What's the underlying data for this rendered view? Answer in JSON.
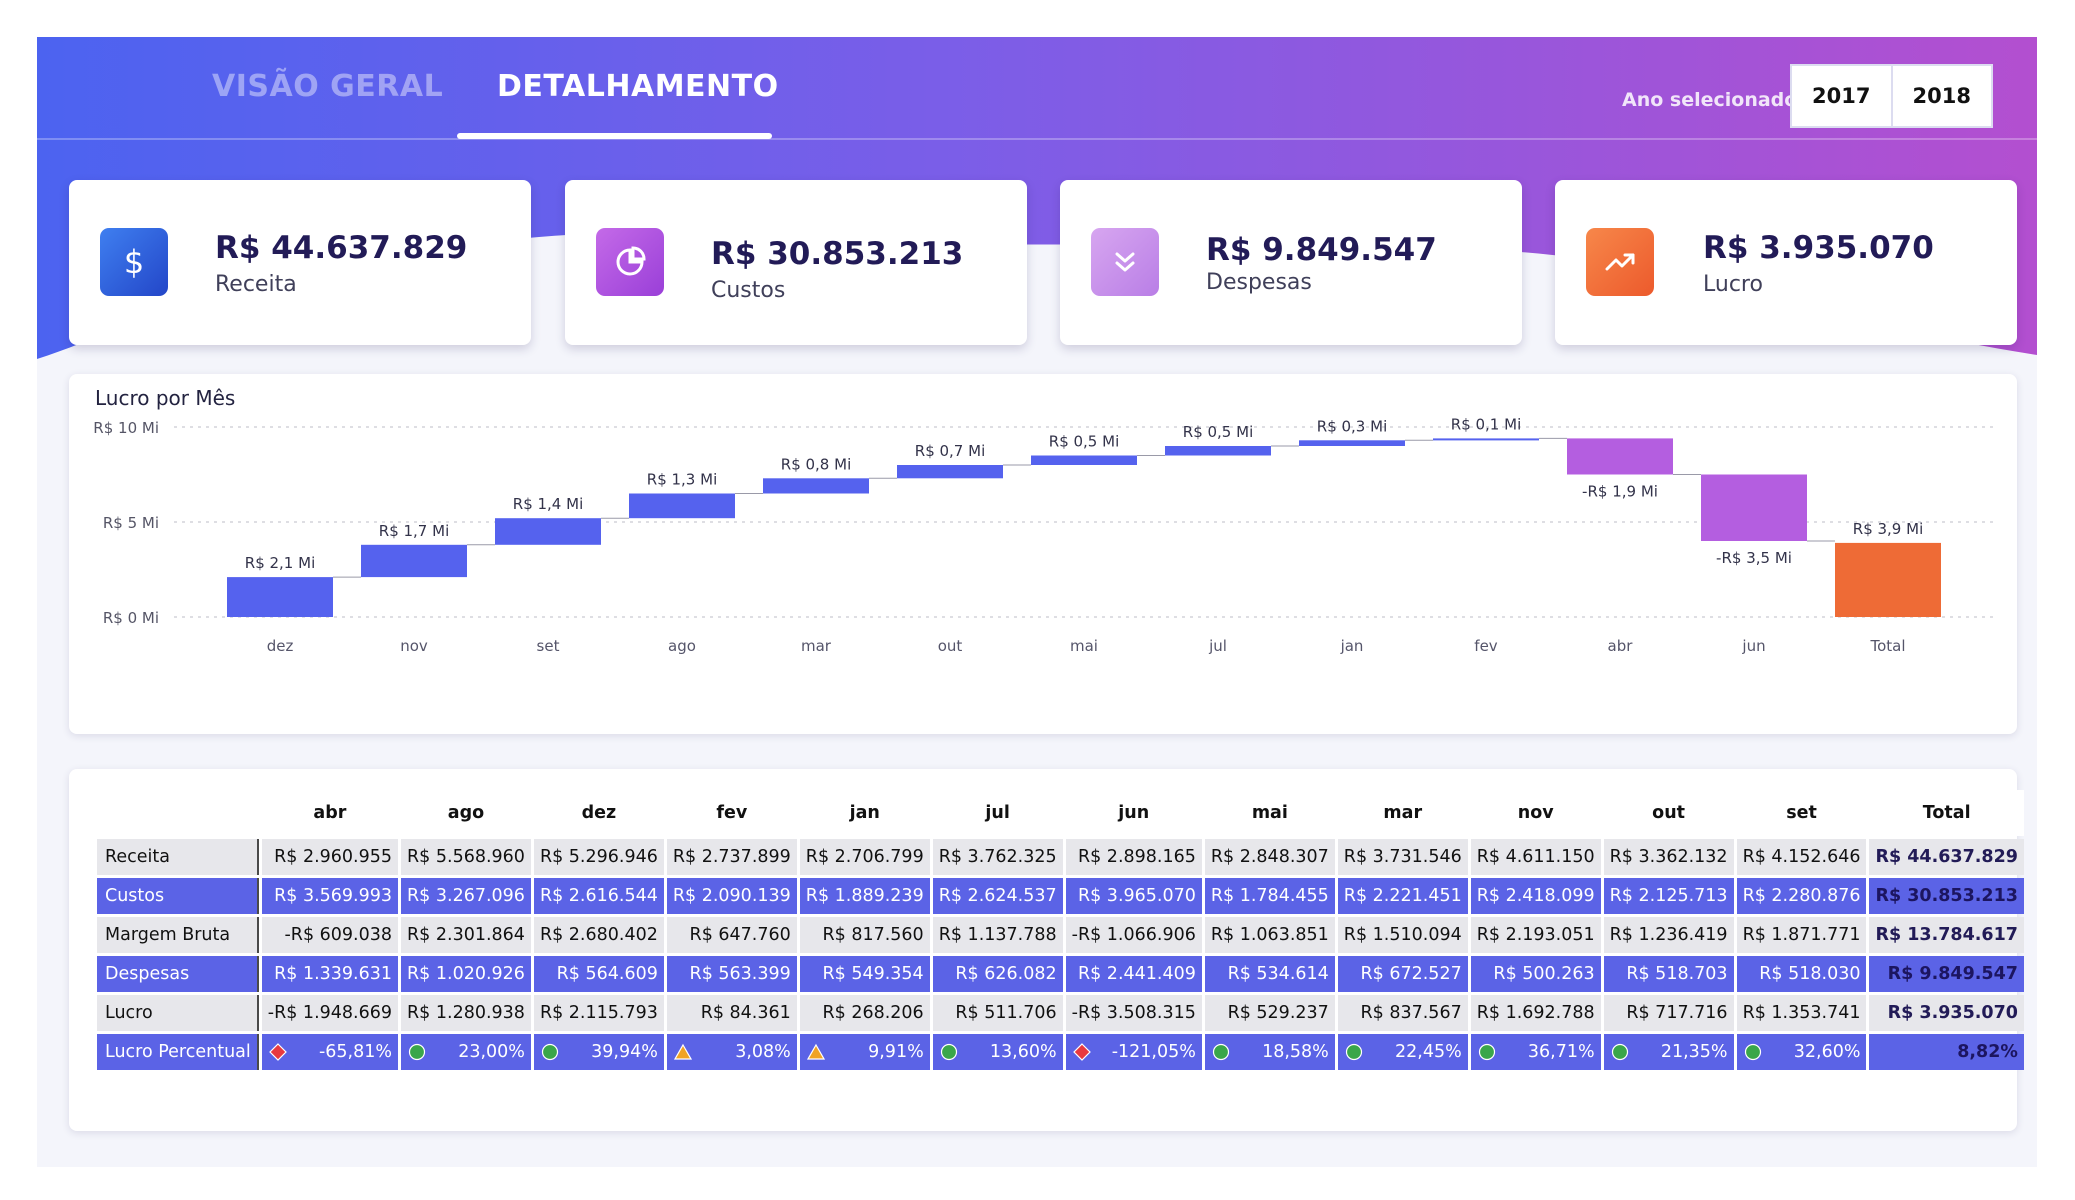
{
  "header": {
    "tabs": [
      {
        "label": "VISÃO GERAL",
        "active": false
      },
      {
        "label": "DETALHAMENTO",
        "active": true
      }
    ],
    "year_label": "Ano selecionado:",
    "years": [
      "2017",
      "2018"
    ]
  },
  "kpis": [
    {
      "value": "R$ 44.637.829",
      "label": "Receita",
      "icon": "dollar-icon",
      "color": "#3563d8"
    },
    {
      "value": "R$ 30.853.213",
      "label": "Custos",
      "icon": "pie-chart-icon",
      "color": "#a94ee0"
    },
    {
      "value": "R$ 9.849.547",
      "label": "Despesas",
      "icon": "chevrons-down-icon",
      "color": "#c38ee9"
    },
    {
      "value": "R$ 3.935.070",
      "label": "Lucro",
      "icon": "trend-up-icon",
      "color": "#f06a3a"
    }
  ],
  "chart_data": {
    "type": "waterfall",
    "title": "Lucro por Mês",
    "categories": [
      "dez",
      "nov",
      "set",
      "ago",
      "mar",
      "out",
      "mai",
      "jul",
      "jan",
      "fev",
      "abr",
      "jun",
      "Total"
    ],
    "values": [
      2.1,
      1.7,
      1.4,
      1.3,
      0.8,
      0.7,
      0.5,
      0.5,
      0.3,
      0.1,
      -1.9,
      -3.5,
      3.9
    ],
    "data_labels": [
      "R$ 2,1 Mi",
      "R$ 1,7 Mi",
      "R$ 1,4 Mi",
      "R$ 1,3 Mi",
      "R$ 0,8 Mi",
      "R$ 0,7 Mi",
      "R$ 0,5 Mi",
      "R$ 0,5 Mi",
      "R$ 0,3 Mi",
      "R$ 0,1 Mi",
      "-R$ 1,9 Mi",
      "-R$ 3,5 Mi",
      "R$ 3,9 Mi"
    ],
    "y_ticks": [
      {
        "value": 0,
        "label": "R$ 0 Mi"
      },
      {
        "value": 5,
        "label": "R$ 5 Mi"
      },
      {
        "value": 10,
        "label": "R$ 10 Mi"
      }
    ],
    "ylim": [
      0,
      10
    ],
    "grid": true,
    "colors": {
      "increase": "#5562ee",
      "decrease": "#b45ee0",
      "total": "#ee6b36"
    }
  },
  "table": {
    "columns": [
      "abr",
      "ago",
      "dez",
      "fev",
      "jan",
      "jul",
      "jun",
      "mai",
      "mar",
      "nov",
      "out",
      "set",
      "Total"
    ],
    "rows": [
      {
        "label": "Receita",
        "cells": [
          "R$ 2.960.955",
          "R$ 5.568.960",
          "R$ 5.296.946",
          "R$ 2.737.899",
          "R$ 2.706.799",
          "R$ 3.762.325",
          "R$ 2.898.165",
          "R$ 2.848.307",
          "R$ 3.731.546",
          "R$ 4.611.150",
          "R$ 3.362.132",
          "R$ 4.152.646",
          "R$ 44.637.829"
        ]
      },
      {
        "label": "Custos",
        "cells": [
          "R$ 3.569.993",
          "R$ 3.267.096",
          "R$ 2.616.544",
          "R$ 2.090.139",
          "R$ 1.889.239",
          "R$ 2.624.537",
          "R$ 3.965.070",
          "R$ 1.784.455",
          "R$ 2.221.451",
          "R$ 2.418.099",
          "R$ 2.125.713",
          "R$ 2.280.876",
          "R$ 30.853.213"
        ]
      },
      {
        "label": "Margem Bruta",
        "cells": [
          "-R$ 609.038",
          "R$ 2.301.864",
          "R$ 2.680.402",
          "R$ 647.760",
          "R$ 817.560",
          "R$ 1.137.788",
          "-R$ 1.066.906",
          "R$ 1.063.851",
          "R$ 1.510.094",
          "R$ 2.193.051",
          "R$ 1.236.419",
          "R$ 1.871.771",
          "R$ 13.784.617"
        ]
      },
      {
        "label": "Despesas",
        "cells": [
          "R$ 1.339.631",
          "R$ 1.020.926",
          "R$ 564.609",
          "R$ 563.399",
          "R$ 549.354",
          "R$ 626.082",
          "R$ 2.441.409",
          "R$ 534.614",
          "R$ 672.527",
          "R$ 500.263",
          "R$ 518.703",
          "R$ 518.030",
          "R$ 9.849.547"
        ]
      },
      {
        "label": "Lucro",
        "cells": [
          "-R$ 1.948.669",
          "R$ 1.280.938",
          "R$ 2.115.793",
          "R$ 84.361",
          "R$ 268.206",
          "R$ 511.706",
          "-R$ 3.508.315",
          "R$ 529.237",
          "R$ 837.567",
          "R$ 1.692.788",
          "R$ 717.716",
          "R$ 1.353.741",
          "R$ 3.935.070"
        ]
      },
      {
        "label": "Lucro Percentual",
        "cells": [
          "-65,81%",
          "23,00%",
          "39,94%",
          "3,08%",
          "9,91%",
          "13,60%",
          "-121,05%",
          "18,58%",
          "22,45%",
          "36,71%",
          "21,35%",
          "32,60%",
          "8,82%"
        ],
        "indicators": [
          "diamond",
          "circle",
          "circle",
          "triangle",
          "triangle",
          "circle",
          "diamond",
          "circle",
          "circle",
          "circle",
          "circle",
          "circle",
          ""
        ]
      }
    ],
    "indicator_colors": {
      "diamond": "#e8393f",
      "circle": "#3aa64a",
      "triangle": "#f0a325"
    }
  }
}
